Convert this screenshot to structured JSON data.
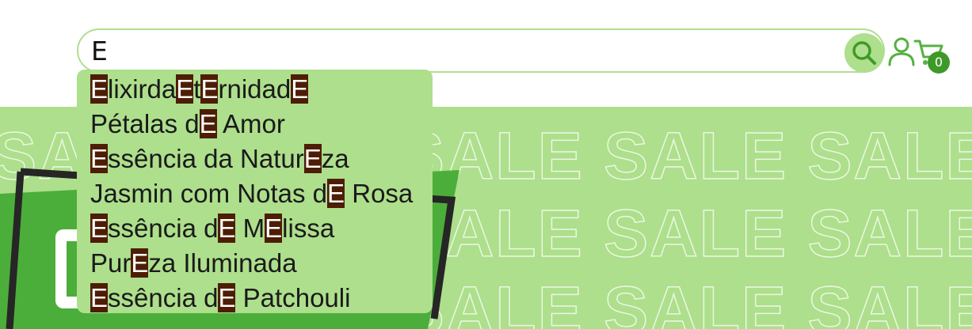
{
  "search": {
    "query": "E",
    "highlight_letter": "E"
  },
  "hero": {
    "sale_word": "SALE"
  },
  "cart": {
    "count": "0"
  },
  "suggestions": [
    "ElixirdaEtErnidadE",
    "Pétalas dE Amor",
    "Essência da NaturEza",
    "Jasmin com Notas dE Rosa",
    "Essência dE MElissa",
    "PurEza Iluminada",
    "Essência dE Patchouli"
  ],
  "colors": {
    "accent_light": "#aedf8c",
    "accent_dark": "#3e9a28",
    "highlight_bg": "#4d1d04"
  },
  "icons": [
    "search-icon",
    "user-icon",
    "cart-icon"
  ]
}
